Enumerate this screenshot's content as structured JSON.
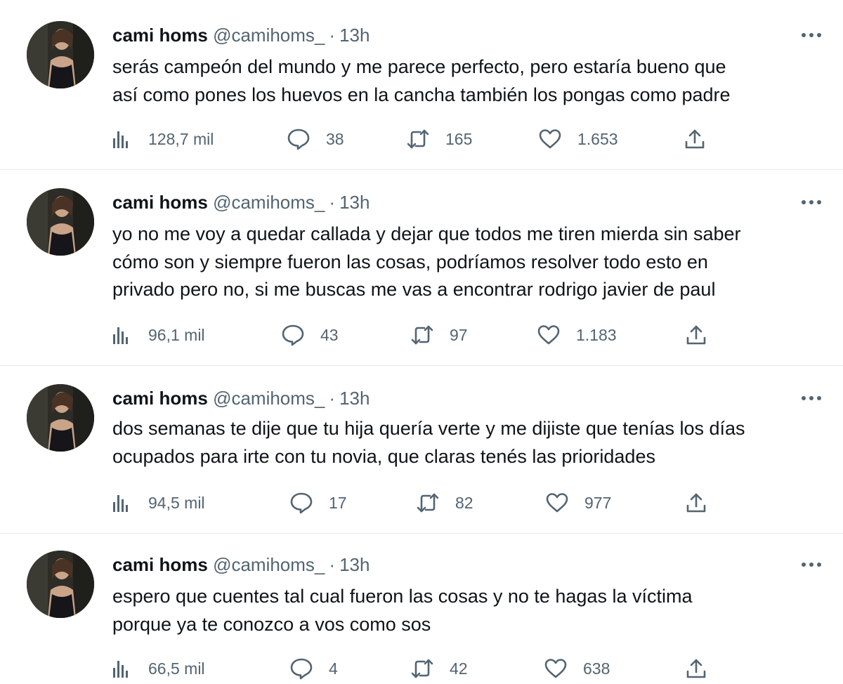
{
  "tweets": [
    {
      "name": "cami homs",
      "handle": "@camihoms_",
      "dot": "·",
      "time": "13h",
      "lines": [
        "serás campeón del mundo y me parece perfecto, pero estaría bueno que",
        "así como pones los huevos en la cancha también los pongas como padre"
      ],
      "views": "128,7 mil",
      "replies": "38",
      "retweets": "165",
      "likes": "1.653"
    },
    {
      "name": "cami homs",
      "handle": "@camihoms_",
      "dot": "·",
      "time": "13h",
      "lines": [
        "yo no me voy a quedar callada y dejar que todos me tiren mierda sin saber",
        "cómo son y siempre fueron las cosas, podríamos resolver todo esto en",
        "privado pero no, si me buscas me vas a encontrar rodrigo javier de paul"
      ],
      "views": "96,1 mil",
      "replies": "43",
      "retweets": "97",
      "likes": "1.183"
    },
    {
      "name": "cami homs",
      "handle": "@camihoms_",
      "dot": "·",
      "time": "13h",
      "lines": [
        "dos semanas te dije que tu hija quería verte y me dijiste que tenías los días",
        "ocupados para irte con tu novia, que claras tenés las prioridades"
      ],
      "views": "94,5 mil",
      "replies": "17",
      "retweets": "82",
      "likes": "977"
    },
    {
      "name": "cami homs",
      "handle": "@camihoms_",
      "dot": "·",
      "time": "13h",
      "lines": [
        "espero que cuentes tal cual fueron las cosas y no te hagas la víctima",
        "porque ya te conozco a vos como sos"
      ],
      "views": "66,5 mil",
      "replies": "4",
      "retweets": "42",
      "likes": "638"
    }
  ],
  "colors": {
    "text": "#0f1419",
    "secondary": "#536471",
    "divider": "#e7e9ea",
    "background": "#ffffff"
  },
  "icons": {
    "views": "bar-chart-icon",
    "reply": "speech-bubble-icon",
    "retweet": "retweet-arrows-icon",
    "like": "heart-icon",
    "share": "upload-icon",
    "more": "three-dots-icon"
  }
}
